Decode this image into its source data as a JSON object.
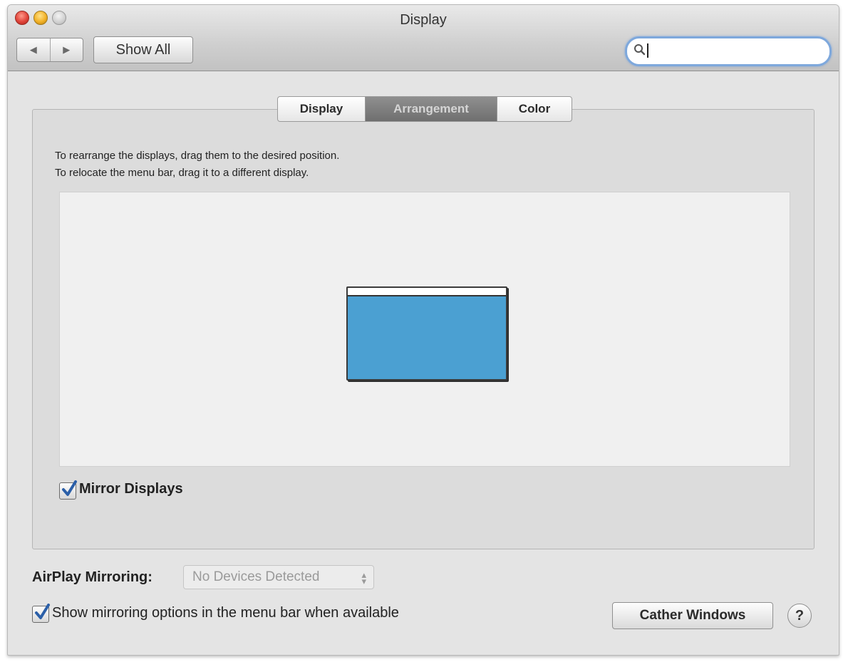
{
  "window": {
    "title": "Display",
    "nav": {
      "back_glyph": "◀",
      "forward_glyph": "▶"
    },
    "show_all_label": "Show All",
    "search": {
      "value": "",
      "placeholder": ""
    }
  },
  "tabs": [
    {
      "label": "Display",
      "active": false
    },
    {
      "label": "Arrangement",
      "active": true
    },
    {
      "label": "Color",
      "active": false
    }
  ],
  "arrangement": {
    "instruction_1": "To rearrange the displays, drag them to the desired position.",
    "instruction_2": "To relocate the menu bar, drag it to a different display.",
    "mirror_displays": {
      "label": "Mirror Displays",
      "checked": true
    }
  },
  "airplay": {
    "label": "AirPlay Mirroring:",
    "selected": "No Devices Detected",
    "enabled": false
  },
  "show_mirroring": {
    "label": "Show mirroring options in the menu bar when available",
    "checked": true
  },
  "gather_windows_label": "Cather Windows",
  "help_label": "?",
  "colors": {
    "display_fill": "#4ba0d2",
    "check_color": "#2b5fa8",
    "active_tab": "#7f7f7f",
    "search_focus": "#7ea8dc"
  },
  "icons": {
    "close": "close-button",
    "minimize": "minimize-button",
    "zoom": "zoom-button",
    "search": "search-icon",
    "checkbox": "checkmark-icon",
    "popup": "updown-chevron-icon",
    "help": "help-icon"
  }
}
